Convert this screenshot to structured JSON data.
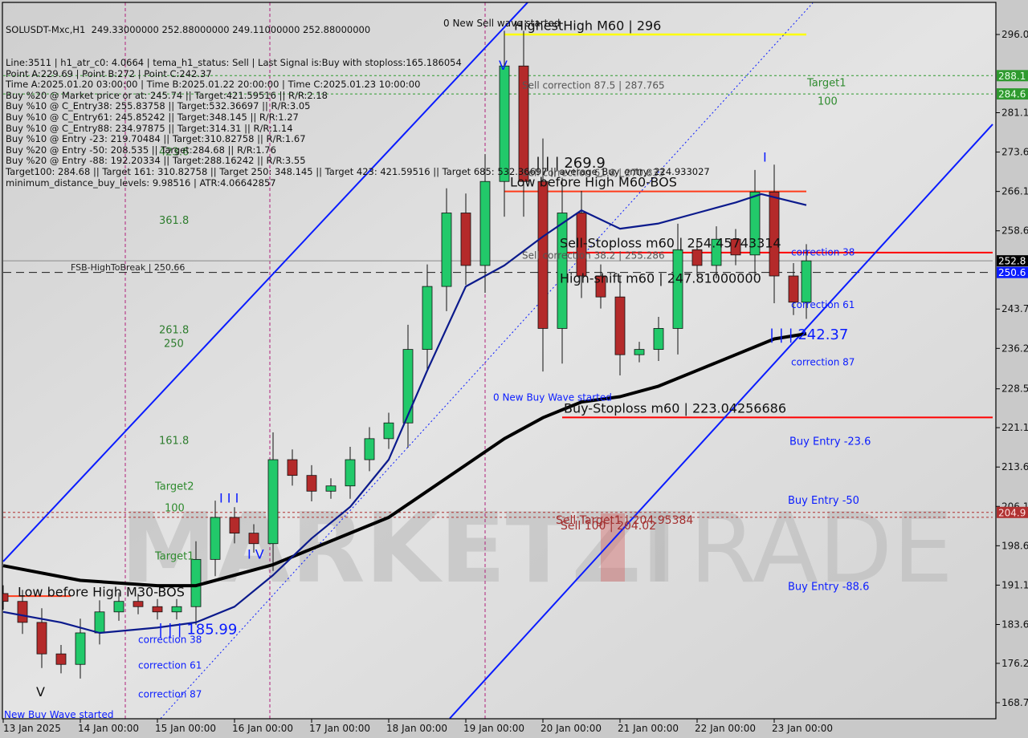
{
  "chart_data": {
    "type": "candlestick",
    "symbol_header": "SOLUSDT-Mxc,H1  249.33000000 252.88000000 249.11000000 252.88000000",
    "info_lines": [
      "Line:3511 | h1_atr_c0: 4.0664 | tema_h1_status: Sell | Last Signal is:Buy with stoploss:165.186054",
      "Point A:229.69 | Point B:272 | Point C:242.37",
      "Time A:2025.01.20 03:00:00 | Time B:2025.01.22 20:00:00 | Time C:2025.01.23 10:00:00",
      "Buy %20 @ Market price or at: 245.74 || Target:421.59516 || R/R:2.18",
      "Buy %10 @ C_Entry38: 255.83758 || Target:532.36697 || R/R:3.05",
      "Buy %10 @ C_Entry61: 245.85242 || Target:348.145 || R/R:1.27",
      "Buy %10 @ C_Entry88: 234.97875 || Target:314.31 || R/R:1.14",
      "Buy %10 @ Entry -23: 219.70484 || Target:310.82758 || R/R:1.67",
      "Buy %20 @ Entry -50: 208.535 || Target:284.68 || R/R:1.76",
      "Buy %20 @ Entry -88: 192.20334 || Target:288.16242 || R/R:3.55",
      "Target100: 284.68 || Target 161: 310.82758 || Target 250: 348.145 || Target 423: 421.59516 || Target 685: 532.36697 || average_Buy_entry: 224.933027",
      "minimum_distance_buy_levels: 9.98516 | ATR:4.06642857"
    ],
    "ylim": [
      168.7,
      296.0
    ],
    "y_ticks": [
      "296.0",
      "281.1",
      "273.6",
      "266.1",
      "258.6",
      "243.7",
      "236.2",
      "228.5",
      "221.1",
      "213.6",
      "206.1",
      "198.6",
      "191.1",
      "183.6",
      "176.2",
      "168.7"
    ],
    "y_tick_values": [
      296.0,
      281.1,
      273.6,
      266.1,
      258.6,
      243.7,
      236.2,
      228.5,
      221.1,
      213.6,
      206.1,
      198.6,
      191.1,
      183.6,
      176.2,
      168.7
    ],
    "price_tags": [
      {
        "text": "288.1",
        "value": 288.16,
        "bg": "#2e9a2e",
        "fg": "#e8ffe8"
      },
      {
        "text": "284.6",
        "value": 284.68,
        "bg": "#2e9a2e",
        "fg": "#e8ffe8"
      },
      {
        "text": "252.8",
        "value": 252.88,
        "bg": "#000000",
        "fg": "#ffffff"
      },
      {
        "text": "250.6",
        "value": 250.66,
        "bg": "#0a1cff",
        "fg": "#ffffff"
      },
      {
        "text": "204.9",
        "value": 204.95,
        "bg": "#b03030",
        "fg": "#ffe0e0"
      }
    ],
    "x_ticks": [
      {
        "label": "13 Jan 2025",
        "time": "2025-01-13 00:00"
      },
      {
        "label": "14 Jan 00:00",
        "time": "2025-01-14 00:00"
      },
      {
        "label": "15 Jan 00:00",
        "time": "2025-01-15 00:00"
      },
      {
        "label": "16 Jan 00:00",
        "time": "2025-01-16 00:00"
      },
      {
        "label": "17 Jan 00:00",
        "time": "2025-01-17 00:00"
      },
      {
        "label": "18 Jan 00:00",
        "time": "2025-01-18 00:00"
      },
      {
        "label": "19 Jan 00:00",
        "time": "2025-01-19 00:00"
      },
      {
        "label": "20 Jan 00:00",
        "time": "2025-01-20 00:00"
      },
      {
        "label": "21 Jan 00:00",
        "time": "2025-01-21 00:00"
      },
      {
        "label": "22 Jan 00:00",
        "time": "2025-01-22 00:00"
      },
      {
        "label": "23 Jan 00:00",
        "time": "2025-01-23 00:00"
      }
    ],
    "closes": [
      [
        "2025-01-13 00:00",
        188
      ],
      [
        "2025-01-13 06:00",
        184
      ],
      [
        "2025-01-13 12:00",
        178
      ],
      [
        "2025-01-13 18:00",
        176
      ],
      [
        "2025-01-14 00:00",
        182
      ],
      [
        "2025-01-14 06:00",
        186
      ],
      [
        "2025-01-14 12:00",
        188
      ],
      [
        "2025-01-14 18:00",
        187
      ],
      [
        "2025-01-15 00:00",
        186
      ],
      [
        "2025-01-15 06:00",
        187
      ],
      [
        "2025-01-15 12:00",
        196
      ],
      [
        "2025-01-15 18:00",
        204
      ],
      [
        "2025-01-16 00:00",
        201
      ],
      [
        "2025-01-16 06:00",
        199
      ],
      [
        "2025-01-16 12:00",
        215
      ],
      [
        "2025-01-16 18:00",
        212
      ],
      [
        "2025-01-17 00:00",
        209
      ],
      [
        "2025-01-17 06:00",
        210
      ],
      [
        "2025-01-17 12:00",
        215
      ],
      [
        "2025-01-17 18:00",
        219
      ],
      [
        "2025-01-18 00:00",
        222
      ],
      [
        "2025-01-18 06:00",
        236
      ],
      [
        "2025-01-18 12:00",
        248
      ],
      [
        "2025-01-18 18:00",
        262
      ],
      [
        "2025-01-19 00:00",
        252
      ],
      [
        "2025-01-19 06:00",
        268
      ],
      [
        "2025-01-19 12:00",
        290
      ],
      [
        "2025-01-19 18:00",
        268
      ],
      [
        "2025-01-20 00:00",
        240
      ],
      [
        "2025-01-20 06:00",
        262
      ],
      [
        "2025-01-20 12:00",
        250
      ],
      [
        "2025-01-20 18:00",
        246
      ],
      [
        "2025-01-21 00:00",
        235
      ],
      [
        "2025-01-21 06:00",
        236
      ],
      [
        "2025-01-21 12:00",
        240
      ],
      [
        "2025-01-21 18:00",
        255
      ],
      [
        "2025-01-22 00:00",
        252
      ],
      [
        "2025-01-22 06:00",
        257
      ],
      [
        "2025-01-22 12:00",
        254
      ],
      [
        "2025-01-22 18:00",
        266
      ],
      [
        "2025-01-23 00:00",
        250
      ],
      [
        "2025-01-23 06:00",
        245
      ],
      [
        "2025-01-23 10:00",
        252.88
      ]
    ],
    "ma_slow": {
      "color": "#000000",
      "points": [
        [
          "2025-01-13 00:00",
          194.8
        ],
        [
          "2025-01-14 00:00",
          192
        ],
        [
          "2025-01-15 00:00",
          191
        ],
        [
          "2025-01-15 12:00",
          191
        ],
        [
          "2025-01-16 12:00",
          195
        ],
        [
          "2025-01-17 12:00",
          201
        ],
        [
          "2025-01-18 00:00",
          204
        ],
        [
          "2025-01-18 12:00",
          209
        ],
        [
          "2025-01-19 00:00",
          214
        ],
        [
          "2025-01-19 12:00",
          219
        ],
        [
          "2025-01-20 00:00",
          223
        ],
        [
          "2025-01-20 12:00",
          226
        ],
        [
          "2025-01-21 00:00",
          227
        ],
        [
          "2025-01-21 12:00",
          229
        ],
        [
          "2025-01-22 00:00",
          232
        ],
        [
          "2025-01-22 12:00",
          235
        ],
        [
          "2025-01-23 00:00",
          238
        ],
        [
          "2025-01-23 10:00",
          239
        ]
      ]
    },
    "ma_fast": {
      "color": "#0b1a8c",
      "points": [
        [
          "2025-01-13 00:00",
          186
        ],
        [
          "2025-01-13 18:00",
          184
        ],
        [
          "2025-01-14 06:00",
          182
        ],
        [
          "2025-01-15 00:00",
          183
        ],
        [
          "2025-01-15 12:00",
          184
        ],
        [
          "2025-01-16 00:00",
          187
        ],
        [
          "2025-01-16 12:00",
          193
        ],
        [
          "2025-01-17 00:00",
          200
        ],
        [
          "2025-01-17 12:00",
          206
        ],
        [
          "2025-01-18 00:00",
          215
        ],
        [
          "2025-01-18 12:00",
          232
        ],
        [
          "2025-01-19 00:00",
          248
        ],
        [
          "2025-01-19 12:00",
          252
        ],
        [
          "2025-01-20 00:00",
          257.5
        ],
        [
          "2025-01-20 12:00",
          262.5
        ],
        [
          "2025-01-21 00:00",
          259
        ],
        [
          "2025-01-21 12:00",
          260
        ],
        [
          "2025-01-22 00:00",
          262
        ],
        [
          "2025-01-22 12:00",
          264
        ],
        [
          "2025-01-22 20:00",
          265.6
        ],
        [
          "2025-01-23 10:00",
          263.5
        ]
      ]
    },
    "channel_lines": [
      {
        "from": [
          "2025-01-13 00:00",
          195.6
        ],
        "to": [
          "2025-01-19 20:00",
          302.6
        ],
        "color": "#0a1cff",
        "style": "solid"
      },
      {
        "from": [
          "2025-01-18 19:00",
          165.7
        ],
        "to": [
          "2025-01-25 20:00",
          278.9
        ],
        "color": "#0a1cff",
        "style": "solid"
      },
      {
        "from": [
          "2025-01-15 01:00",
          165.7
        ],
        "to": [
          "2025-01-23 12:00",
          302.0
        ],
        "color": "#0a1cff",
        "style": "dotted"
      }
    ],
    "levels": [
      {
        "value": 296.0,
        "from": "2025-01-19 12:00",
        "to": "2025-01-23 10:00",
        "color": "#ffff00",
        "style": "solid",
        "width": 2.5
      },
      {
        "value": 266.1,
        "from": "2025-01-19 12:00",
        "to": "2025-01-23 10:00",
        "color": "#ff3b1a",
        "style": "solid",
        "width": 2
      },
      {
        "value": 254.457,
        "from": "2025-01-20 05:00",
        "to": "2025-01-25 20:00",
        "color": "#ff0000",
        "style": "solid",
        "width": 2
      },
      {
        "value": 223.043,
        "from": "2025-01-20 06:00",
        "to": "2025-01-25 20:00",
        "color": "#ff0000",
        "style": "solid",
        "width": 2
      },
      {
        "value": 288.16,
        "from": "2025-01-13 00:00",
        "to": "2025-01-25 20:00",
        "color": "#2e9a2e",
        "style": "dashed",
        "width": 1
      },
      {
        "value": 284.68,
        "from": "2025-01-13 00:00",
        "to": "2025-01-25 20:00",
        "color": "#2e9a2e",
        "style": "dashed",
        "width": 1
      },
      {
        "value": 204.95,
        "from": "2025-01-13 00:00",
        "to": "2025-01-25 20:00",
        "color": "#b03030",
        "style": "dashed",
        "width": 1
      },
      {
        "value": 204.02,
        "from": "2025-01-13 00:00",
        "to": "2025-01-25 20:00",
        "color": "#b03030",
        "style": "dashed",
        "width": 1
      },
      {
        "value": 252.88,
        "from": "2025-01-13 00:00",
        "to": "2025-01-25 20:00",
        "color": "#8a8a8a",
        "style": "solid",
        "width": 1
      },
      {
        "value": 250.66,
        "from": "2025-01-13 00:00",
        "to": "2025-01-25 20:00",
        "color": "#1a1a1a",
        "style": "longdash",
        "width": 1
      },
      {
        "value": 189.0,
        "from": "2025-01-13 01:00",
        "to": "2025-01-13 21:00",
        "color": "#ff3b1a",
        "style": "solid",
        "width": 2
      }
    ],
    "vertical_markers": [
      "2025-01-14 14:00",
      "2025-01-16 11:00",
      "2025-01-19 06:00"
    ],
    "annotations": [
      {
        "text": "0 New Sell wave started",
        "time": "2025-01-18 17:00",
        "price": 298.1,
        "color": "#111111",
        "size": 12
      },
      {
        "text": "HighestHigh   M60 | 296",
        "time": "2025-01-19 15:00",
        "price": 297.5,
        "color": "#111111",
        "size": 16
      },
      {
        "text": "Sell correction 87.5 | 287.765",
        "time": "2025-01-19 17:30",
        "price": 286.2,
        "color": "#555555",
        "size": 12
      },
      {
        "text": "Target1",
        "time": "2025-01-23 10:15",
        "price": 286.7,
        "color": "#2e8b2e",
        "size": 13
      },
      {
        "text": "100",
        "time": "2025-01-23 13:30",
        "price": 283.2,
        "color": "#2e8b2e",
        "size": 13
      },
      {
        "text": "| | | 269.9",
        "time": "2025-01-19 21:45",
        "price": 271.4,
        "color": "#111111",
        "size": 18
      },
      {
        "text": "Sell correction 61.8 | 270.833",
        "time": "2025-01-19 17:30",
        "price": 269.6,
        "color": "#555555",
        "size": 12
      },
      {
        "text": "Low before High   M60-BOS",
        "time": "2025-01-19 13:45",
        "price": 267.7,
        "color": "#111111",
        "size": 16
      },
      {
        "text": "Sell-Stoploss m60 | 254.45743314",
        "time": "2025-01-20 05:15",
        "price": 256.1,
        "color": "#111111",
        "size": 16
      },
      {
        "text": "Sell correction 38.2 | 255.286",
        "time": "2025-01-19 17:30",
        "price": 253.8,
        "color": "#555555",
        "size": 12
      },
      {
        "text": "High-shift m60 | 247.81000000",
        "time": "2025-01-20 05:15",
        "price": 249.4,
        "color": "#111111",
        "size": 16
      },
      {
        "text": "correction 38",
        "time": "2025-01-23 05:15",
        "price": 254.4,
        "color": "#0a1cff",
        "size": 12
      },
      {
        "text": "correction 61",
        "time": "2025-01-23 05:15",
        "price": 244.4,
        "color": "#0a1cff",
        "size": 12
      },
      {
        "text": "| | | 242.37",
        "time": "2025-01-22 22:30",
        "price": 238.7,
        "color": "#0a1cff",
        "size": 18
      },
      {
        "text": "correction 87",
        "time": "2025-01-23 05:15",
        "price": 233.5,
        "color": "#0a1cff",
        "size": 12
      },
      {
        "text": "0 New Buy Wave started",
        "time": "2025-01-19 08:30",
        "price": 226.8,
        "color": "#0a1cff",
        "size": 12
      },
      {
        "text": "Buy-Stoploss m60 | 223.04256686",
        "time": "2025-01-20 06:30",
        "price": 224.6,
        "color": "#111111",
        "size": 16
      },
      {
        "text": "Buy Entry -23.6",
        "time": "2025-01-23 04:45",
        "price": 218.4,
        "color": "#0a1cff",
        "size": 13
      },
      {
        "text": "Buy Entry -50",
        "time": "2025-01-23 04:15",
        "price": 207.1,
        "color": "#0a1cff",
        "size": 13
      },
      {
        "text": "Buy Entry -88.6",
        "time": "2025-01-23 04:15",
        "price": 190.7,
        "color": "#0a1cff",
        "size": 13
      },
      {
        "text": "Sell Target1 | 204.95384",
        "time": "2025-01-20 04:00",
        "price": 203.4,
        "color": "#a33030",
        "size": 14
      },
      {
        "text": "Sell 100 | 204.02",
        "time": "2025-01-20 05:30",
        "price": 202.3,
        "color": "#a33030",
        "size": 14
      },
      {
        "text": "FSB-HighToBreak | 250.66",
        "time": "2025-01-13 21:00",
        "price": 251.5,
        "color": "#222222",
        "size": 11
      },
      {
        "text": "423.6",
        "time": "2025-01-15 00:30",
        "price": 273.5,
        "color": "#2e7d2e",
        "size": 13
      },
      {
        "text": "361.8",
        "time": "2025-01-15 00:30",
        "price": 260.5,
        "color": "#2e7d2e",
        "size": 13
      },
      {
        "text": "261.8",
        "time": "2025-01-15 00:30",
        "price": 239.6,
        "color": "#2e7d2e",
        "size": 13
      },
      {
        "text": "250",
        "time": "2025-01-15 02:00",
        "price": 237.0,
        "color": "#2e7d2e",
        "size": 13
      },
      {
        "text": "161.8",
        "time": "2025-01-15 00:30",
        "price": 218.5,
        "color": "#2e7d2e",
        "size": 13
      },
      {
        "text": "Target2",
        "time": "2025-01-14 23:15",
        "price": 209.8,
        "color": "#2e8b2e",
        "size": 13
      },
      {
        "text": "100",
        "time": "2025-01-15 02:15",
        "price": 205.7,
        "color": "#2e8b2e",
        "size": 13
      },
      {
        "text": "Target1",
        "time": "2025-01-14 23:15",
        "price": 196.5,
        "color": "#2e8b2e",
        "size": 13
      },
      {
        "text": "Low before High   M30-BOS",
        "time": "2025-01-13 04:30",
        "price": 189.6,
        "color": "#111111",
        "size": 16
      },
      {
        "text": "| | | 185.99",
        "time": "2025-01-15 00:15",
        "price": 182.5,
        "color": "#0a1cff",
        "size": 18
      },
      {
        "text": "correction 38",
        "time": "2025-01-14 18:00",
        "price": 180.6,
        "color": "#0a1cff",
        "size": 12
      },
      {
        "text": "correction 61",
        "time": "2025-01-14 18:00",
        "price": 175.7,
        "color": "#0a1cff",
        "size": 12
      },
      {
        "text": "correction 87",
        "time": "2025-01-14 18:00",
        "price": 170.2,
        "color": "#0a1cff",
        "size": 12
      },
      {
        "text": "New Buy Wave started",
        "time": "2025-01-13 00:15",
        "price": 166.3,
        "color": "#0a1cff",
        "size": 12
      },
      {
        "text": "V",
        "time": "2025-01-19 10:15",
        "price": 290.0,
        "color": "#0a1cff",
        "size": 16
      },
      {
        "text": "V",
        "time": "2025-01-13 10:15",
        "price": 170.6,
        "color": "#111111",
        "size": 16
      },
      {
        "text": "I I I",
        "time": "2025-01-15 19:15",
        "price": 207.5,
        "color": "#0a1cff",
        "size": 16
      },
      {
        "text": "I V",
        "time": "2025-01-16 04:00",
        "price": 196.8,
        "color": "#0a1cff",
        "size": 16
      },
      {
        "text": "I",
        "time": "2025-01-22 20:30",
        "price": 272.5,
        "color": "#0a1cff",
        "size": 16
      }
    ]
  },
  "watermark": {
    "text_left": "MARKETZI",
    "text_right": "TRADE"
  }
}
